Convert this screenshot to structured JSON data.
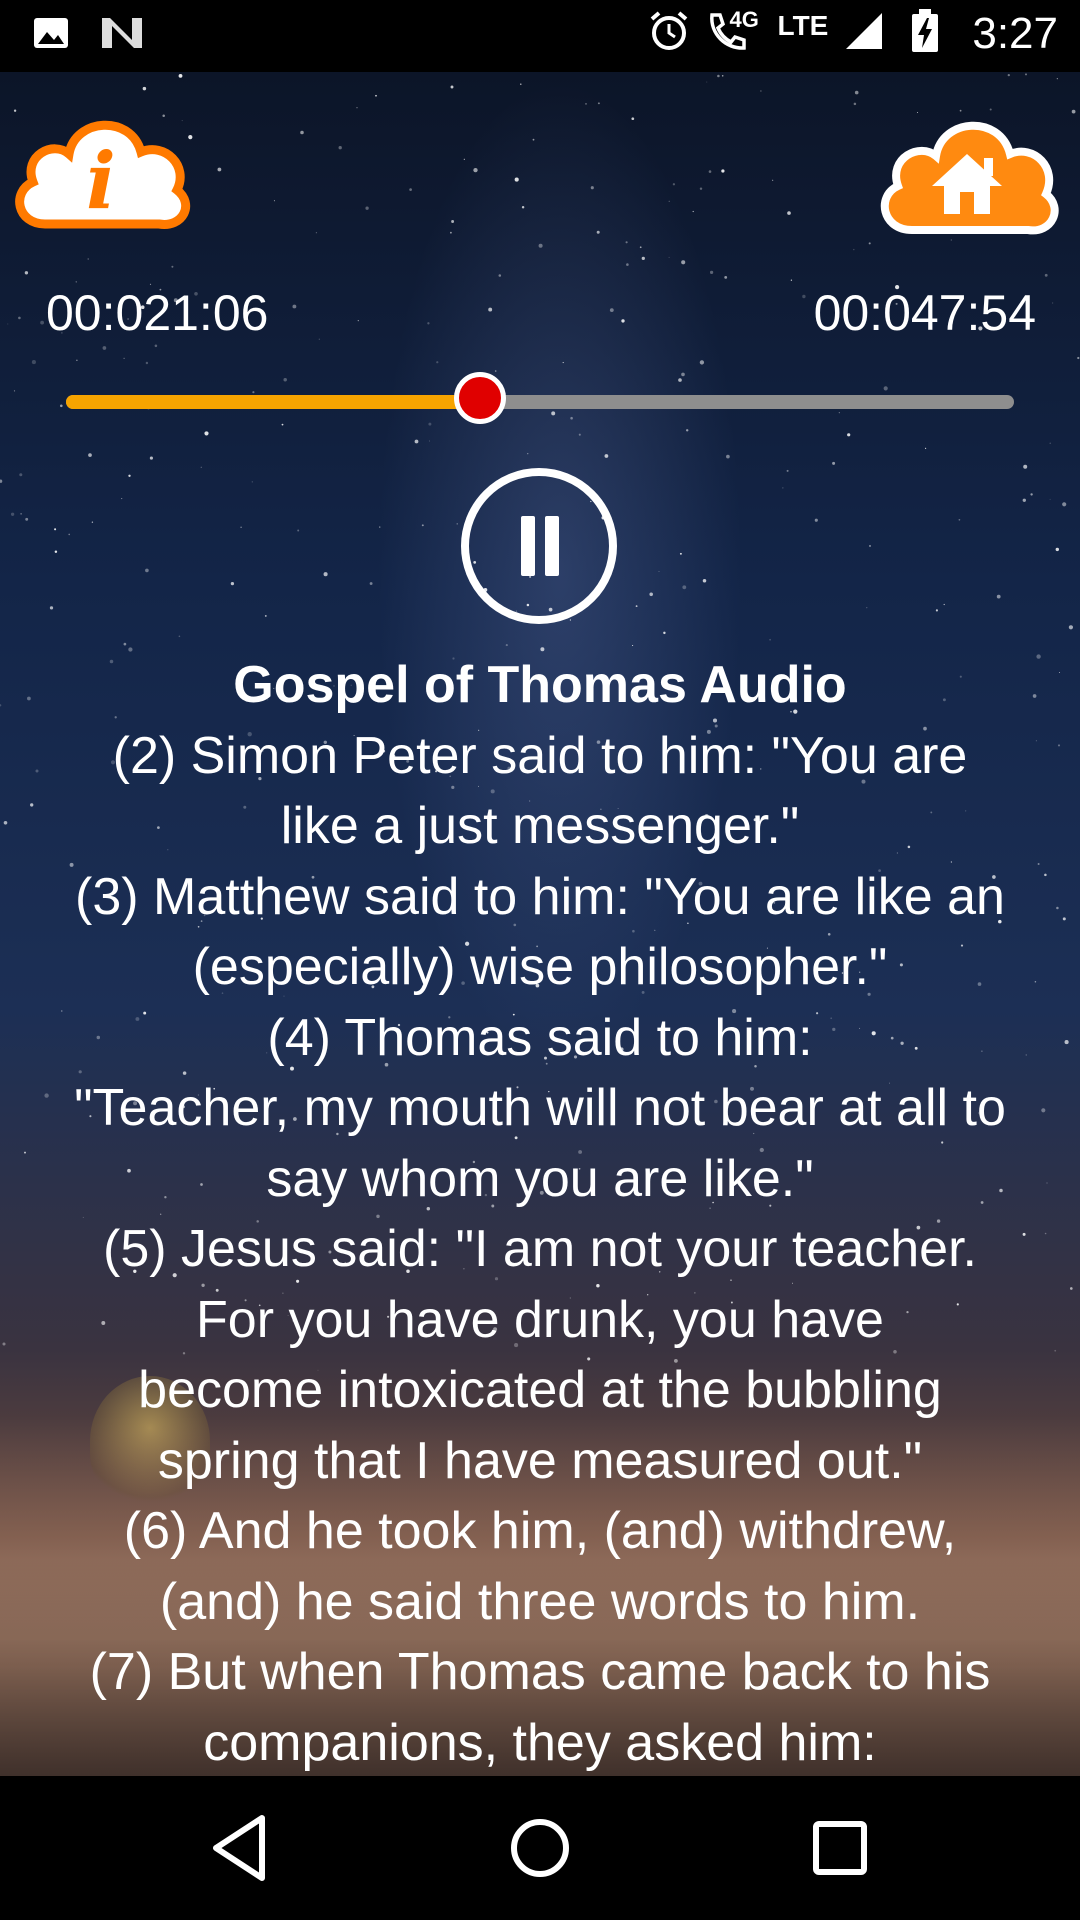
{
  "status_bar": {
    "time": "3:27",
    "network_4g": "4G",
    "network_lte": "LTE",
    "icons": [
      "image-icon",
      "n-notification-icon",
      "alarm-icon",
      "wifi-call-icon",
      "signal-icon",
      "battery-charging-icon"
    ]
  },
  "player": {
    "current_time": "00:021:06",
    "total_time": "00:047:54",
    "progress": 0.437,
    "state": "playing"
  },
  "colors": {
    "seek_fill": "#f7a400",
    "seek_track": "#8e8e8e",
    "seek_thumb": "#e00000",
    "cloud_icon": "#ff7a00"
  },
  "content": {
    "title": "Gospel of Thomas Audio",
    "lines": [
      "(2) Simon Peter said to him: \"You are",
      "like a just messenger.\"",
      "(3) Matthew said to him: \"You are like an",
      "(especially) wise philosopher.\"",
      "(4) Thomas said to him:",
      "\"Teacher, my mouth will not bear at all to",
      "say whom you are like.\"",
      "(5) Jesus said: \"I am not your teacher.",
      "For you have drunk, you have",
      "become intoxicated at the bubbling",
      "spring that I have measured out.\"",
      "(6) And he took him, (and) withdrew,",
      "(and) he said three words to him.",
      "(7) But when Thomas came back to his",
      "companions, they asked him:"
    ]
  },
  "navigation": {
    "buttons": [
      "back-icon",
      "home-circle-icon",
      "recents-icon"
    ]
  }
}
